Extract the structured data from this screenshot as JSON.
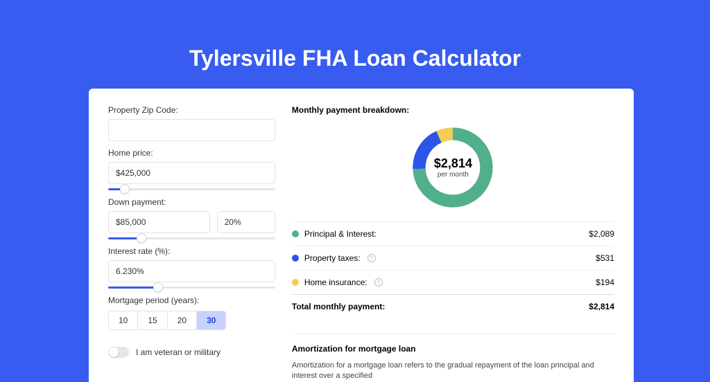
{
  "title": "Tylersville FHA Loan Calculator",
  "form": {
    "zip_label": "Property Zip Code:",
    "zip_value": "",
    "home_price_label": "Home price:",
    "home_price_value": "$425,000",
    "down_label": "Down payment:",
    "down_value": "$85,000",
    "down_pct": "20%",
    "rate_label": "Interest rate (%):",
    "rate_value": "6.230%",
    "period_label": "Mortgage period (years):",
    "periods": [
      "10",
      "15",
      "20",
      "30"
    ],
    "period_active_index": 3,
    "veteran_label": "I am veteran or military",
    "slider_home_fill_pct": 10,
    "slider_down_fill_pct": 20,
    "slider_rate_fill_pct": 30
  },
  "breakdown": {
    "heading": "Monthly payment breakdown:",
    "center_amount": "$2,814",
    "center_sub": "per month",
    "rows": [
      {
        "label": "Principal & Interest:",
        "amount": "$2,089",
        "color": "#52af8b",
        "info": false
      },
      {
        "label": "Property taxes:",
        "amount": "$531",
        "color": "#2c55e8",
        "info": true
      },
      {
        "label": "Home insurance:",
        "amount": "$194",
        "color": "#f2ce52",
        "info": true
      }
    ],
    "total_label": "Total monthly payment:",
    "total_amount": "$2,814"
  },
  "chart_data": {
    "type": "pie",
    "title": "Monthly payment breakdown",
    "series": [
      {
        "name": "Principal & Interest",
        "value": 2089,
        "color": "#52af8b"
      },
      {
        "name": "Property taxes",
        "value": 531,
        "color": "#2c55e8"
      },
      {
        "name": "Home insurance",
        "value": 194,
        "color": "#f2ce52"
      }
    ],
    "total": 2814,
    "center_label": "$2,814 per month"
  },
  "amortization": {
    "heading": "Amortization for mortgage loan",
    "text": "Amortization for a mortgage loan refers to the gradual repayment of the loan principal and interest over a specified"
  }
}
